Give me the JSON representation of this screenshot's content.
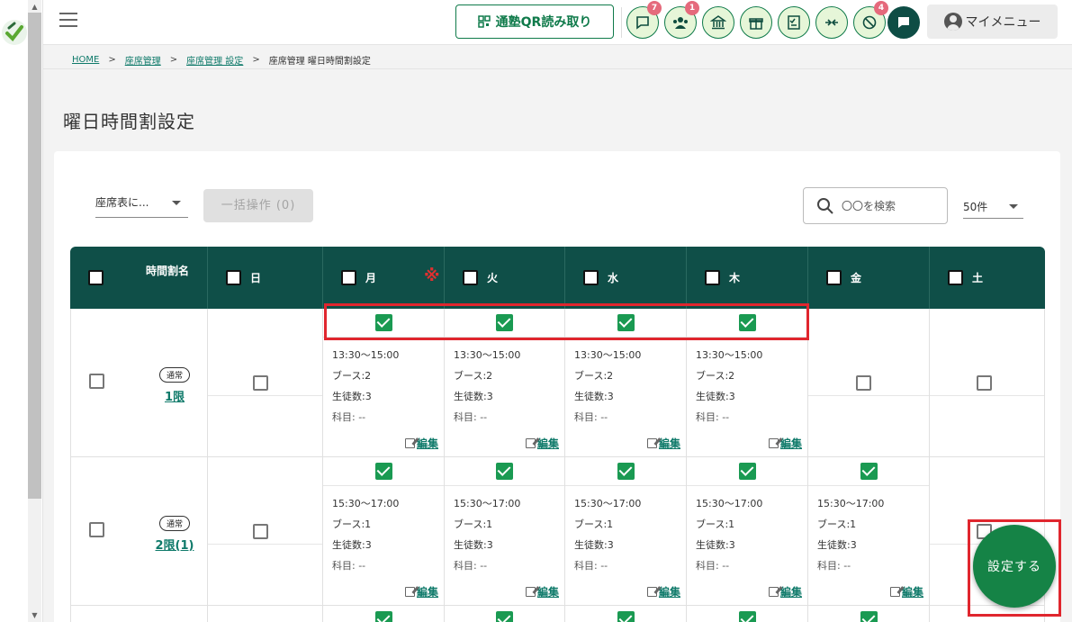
{
  "topbar": {
    "qr_label": "通塾QR読み取り",
    "icons": [
      {
        "name": "chat-icon",
        "badge": "7"
      },
      {
        "name": "group-icon",
        "badge": "1"
      },
      {
        "name": "bank-icon",
        "badge": ""
      },
      {
        "name": "gift-icon",
        "badge": ""
      },
      {
        "name": "checklist-icon",
        "badge": ""
      },
      {
        "name": "merge-icon",
        "badge": ""
      },
      {
        "name": "no-entry-icon",
        "badge": "4"
      },
      {
        "name": "message-icon",
        "badge": ""
      }
    ],
    "my_menu": "マイメニュー"
  },
  "breadcrumb": {
    "home": "HOME",
    "seat_mgmt": "座席管理",
    "seat_settings": "座席管理 設定",
    "current": "座席管理 曜日時間割設定",
    "sep": ">"
  },
  "page_title": "曜日時間割設定",
  "toolbar": {
    "seat_select": "座席表に...",
    "bulk_action": "一括操作 (0)",
    "search_placeholder": "〇〇を検索",
    "per_page": "50件"
  },
  "table": {
    "header_name": "時間割名",
    "days": [
      "日",
      "月",
      "火",
      "水",
      "木",
      "金",
      "土"
    ],
    "note_mark": "※",
    "edit_label": "編集",
    "rows": [
      {
        "tag": "通常",
        "name": "1限",
        "slots": [
          null,
          {
            "time": "13:30〜15:00",
            "booth": "ブース:2",
            "students": "生徒数:3",
            "subject": "科目: --"
          },
          {
            "time": "13:30〜15:00",
            "booth": "ブース:2",
            "students": "生徒数:3",
            "subject": "科目: --"
          },
          {
            "time": "13:30〜15:00",
            "booth": "ブース:2",
            "students": "生徒数:3",
            "subject": "科目: --"
          },
          {
            "time": "13:30〜15:00",
            "booth": "ブース:2",
            "students": "生徒数:3",
            "subject": "科目: --"
          },
          null,
          null
        ]
      },
      {
        "tag": "通常",
        "name": "2限(1)",
        "slots": [
          null,
          {
            "time": "15:30〜17:00",
            "booth": "ブース:1",
            "students": "生徒数:3",
            "subject": "科目: --"
          },
          {
            "time": "15:30〜17:00",
            "booth": "ブース:1",
            "students": "生徒数:3",
            "subject": "科目: --"
          },
          {
            "time": "15:30〜17:00",
            "booth": "ブース:1",
            "students": "生徒数:3",
            "subject": "科目: --"
          },
          {
            "time": "15:30〜17:00",
            "booth": "ブース:1",
            "students": "生徒数:3",
            "subject": "科目: --"
          },
          {
            "time": "15:30〜17:00",
            "booth": "ブース:1",
            "students": "生徒数:3",
            "subject": "科目: --"
          },
          null
        ]
      }
    ]
  },
  "fab_label": "設定する",
  "colors": {
    "header_bg": "#0f4f48",
    "accent": "#0f7a4a",
    "checkbox_checked": "#1a9a52",
    "highlight": "#e0262e"
  }
}
